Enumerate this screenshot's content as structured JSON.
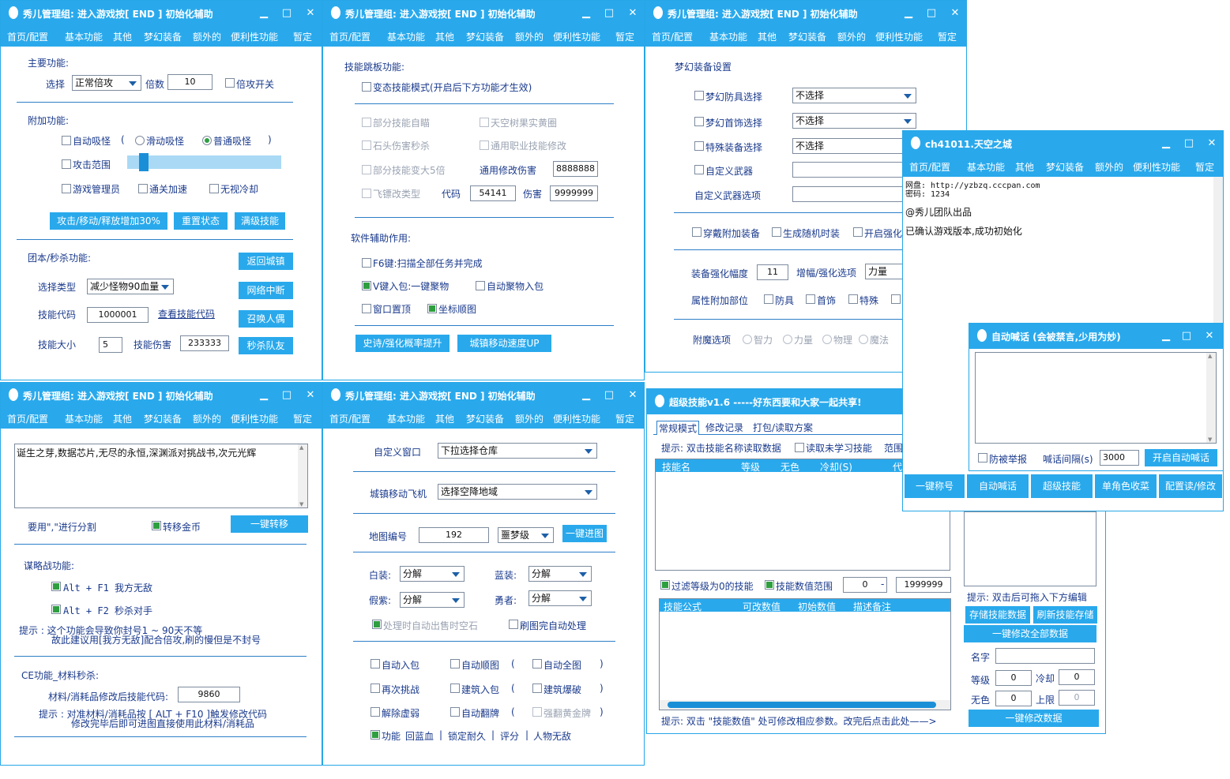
{
  "app": {
    "title": "秀儿管理组:   进入游戏按[ END ] 初始化辅助",
    "menu": [
      "首页/配置",
      "基本功能",
      "其他",
      "梦幻装备",
      "额外的",
      "便利性功能",
      "暂定"
    ],
    "ctl_min": "▁",
    "ctl_max": "□",
    "ctl_close": "✕"
  },
  "w1": {
    "main_title": "主要功能:",
    "select_label": "选择",
    "select_value": "正常倍攻",
    "multiplier_label": "倍数",
    "multiplier_value": "10",
    "multiplier_switch": "倍攻开关",
    "extra_title": "附加功能:",
    "auto_absorb": "自动吸怪",
    "paren_open": "(",
    "slide_absorb": "滑动吸怪",
    "normal_absorb": "普通吸怪",
    "paren_close": ")",
    "attack_range": "攻击范围",
    "game_admin": "游戏管理员",
    "clear_speed": "通关加速",
    "no_cooldown": "无视冷却",
    "btn_speed": "攻击/移动/释放增加30%",
    "btn_reset": "重置状态",
    "btn_fullskill": "满级技能",
    "team_title": "团本/秒杀功能:",
    "btn_return_town": "返回城镇",
    "select_type_label": "选择类型",
    "select_type_value": "减少怪物90血量",
    "btn_net_break": "网络中断",
    "skill_code_label": "技能代码",
    "skill_code_value": "1000001",
    "skill_code_link": "查看技能代码",
    "btn_summon": "召唤人偶",
    "skill_size_label": "技能大小",
    "skill_size_value": "5",
    "skill_dmg_label": "技能伤害",
    "skill_dmg_value": "233333",
    "btn_kill_team": "秒杀队友"
  },
  "w2": {
    "skill_jump_title": "技能跳板功能:",
    "abnormal_mode": "变态技能模式(开启后下方功能才生效)",
    "partial_aim": "部分技能自瞄",
    "sky_tree": "天空树果实黄圈",
    "stone_kill": "石头伤害秒杀",
    "general_skill_mod": "通用职业技能修改",
    "partial_enlarge": "部分技能变大5倍",
    "general_dmg_label": "通用修改伤害",
    "general_dmg_value": "8888888",
    "flying_type": "飞镖改类型",
    "code_label": "代码",
    "code_value": "54141",
    "dmg_label": "伤害",
    "dmg_value": "9999999",
    "software_title": "软件辅助作用:",
    "f6_key": "F6键:扫描全部任务并完成",
    "v_key": "V键入包:一键聚物",
    "auto_collect": "自动聚物入包",
    "window_top": "窗口置顶",
    "coord_map": "坐标顺图",
    "btn_epic_rate": "史诗/强化概率提升",
    "btn_town_speed": "城镇移动速度UP"
  },
  "w3": {
    "dream_title": "梦幻装备设置",
    "dream_armor": "梦幻防具选择",
    "dream_armor_val": "不选择",
    "dream_jewel": "梦幻首饰选择",
    "dream_jewel_val": "不选择",
    "special_equip": "特殊装备选择",
    "special_equip_val": "不选择",
    "custom_weapon": "自定义武器",
    "custom_weapon_opt": "自定义武器选项",
    "wear_extra": "穿戴附加装备",
    "gen_random": "生成随机时装",
    "enable_enhance": "开启强化",
    "enhance_amp_label": "装备强化幅度",
    "enhance_amp_value": "11",
    "amp_option_label": "增幅/强化选项",
    "amp_option_value": "力量",
    "attr_part_label": "属性附加部位",
    "armor": "防具",
    "jewel": "首饰",
    "special": "特殊",
    "enchant_label": "附魔选项",
    "int": "智力",
    "str": "力量",
    "phys": "物理",
    "magic": "魔法"
  },
  "w4": {
    "text_content": "诞生之芽,数据芯片,无尽的永恒,深渊派对挑战书,次元光辉",
    "separator_hint": "要用\",\"进行分割",
    "transfer_gold": "转移金币",
    "btn_transfer": "一键转移",
    "strategy_title": "谋略战功能:",
    "alt_f1": "Alt + F1 我方无敌",
    "alt_f2": "Alt + F2 秒杀对手",
    "tip_line1": "提示 : 这个功能会导致你封号1 ~ 90天不等",
    "tip_line2": "故此建议用[我方无敌]配合倍攻,刷的慢但是不封号",
    "ce_title": "CE功能_材料秒杀:",
    "material_label": "材料/消耗品修改后技能代码:",
    "material_value": "9860",
    "tip2_line1": "提示 : 对准材料/消耗品按 [ ALT + F10 ]触发修改代码",
    "tip2_line2": "修改完毕后即可进图直接使用此材料/消耗品"
  },
  "w5": {
    "custom_window_label": "自定义窗口",
    "custom_window_value": "下拉选择仓库",
    "town_fly_label": "城镇移动飞机",
    "town_fly_value": "选择空降地域",
    "map_no_label": "地图编号",
    "map_no_value": "192",
    "difficulty_value": "噩梦级",
    "btn_enter_map": "一键进图",
    "white_label": "白装:",
    "white_value": "分解",
    "blue_label": "蓝装:",
    "blue_value": "分解",
    "purple_label": "假紫:",
    "purple_value": "分解",
    "hero_label": "勇者:",
    "hero_value": "分解",
    "auto_sell": "处理时自动出售时空石",
    "auto_process": "刷图完自动处理",
    "auto_pack": "自动入包",
    "auto_route": "自动顺图",
    "auto_full_map": "自动全图",
    "rechallenge": "再次挑战",
    "build_pack": "建筑入包",
    "build_break": "建筑爆破",
    "remove_weak": "解除虚弱",
    "auto_flip": "自动翻牌",
    "force_gold": "强翻黄金牌",
    "func_label": "功能",
    "refill": "回蓝血",
    "lock_dura": "锁定耐久",
    "score": "评分",
    "invincible": "人物无敌",
    "sep": "|"
  },
  "w6": {
    "title": "ch41011.天空之城",
    "log_line1": "网盘: http://yzbzq.cccpan.com",
    "log_line2": "密码: 1234",
    "log_line3": "@秀儿团队出品",
    "log_line4": "已确认游戏版本,成功初始化",
    "btn_title": "一键称号",
    "btn_shout": "自动喊话",
    "btn_superskill": "超级技能",
    "btn_sell": "单角色收菜",
    "btn_config": "配置读/修改"
  },
  "w7": {
    "title": "自动喊话 (会被禁言,少用为妙)",
    "text_value": "",
    "anti_report": "防被举报",
    "interval_label": "喊话间隔(s)",
    "interval_value": "3000",
    "btn_start": "开启自动喊话"
  },
  "w8": {
    "title": "超级技能v1.6 -----好东西要和大家一起共享!",
    "tabs": [
      "常规模式",
      "修改记录",
      "打包/读取方案"
    ],
    "hint_top": "提示: 双击技能名称读取数据",
    "read_unlearned": "读取未学习技能",
    "range_label": "范围",
    "grid1_headers": [
      "技能名",
      "等级",
      "无色",
      "冷却(S)",
      "代"
    ],
    "filter_level": "过滤等级为0的技能",
    "value_range": "技能数值范围",
    "range_min": "0",
    "range_dash": "-",
    "range_max": "1999999",
    "grid2_headers": [
      "技能公式",
      "可改数值",
      "初始数值",
      "描述备注"
    ],
    "hint_bottom": "提示: 双击 \"技能数值\" 处可修改相应参数。改完后点击此处——>",
    "hint_right": "提示: 双击后可拖入下方编辑",
    "btn_store": "存储技能数据",
    "btn_refresh": "刷新技能存储",
    "btn_modify_all": "一键修改全部数据",
    "name_label": "名字",
    "level_label": "等级",
    "level_value": "0",
    "cool_label": "冷却",
    "cool_value": "0",
    "color_label": "无色",
    "color_value": "0",
    "limit_label": "上限",
    "limit_value": "0",
    "btn_modify": "一键修改数据"
  }
}
